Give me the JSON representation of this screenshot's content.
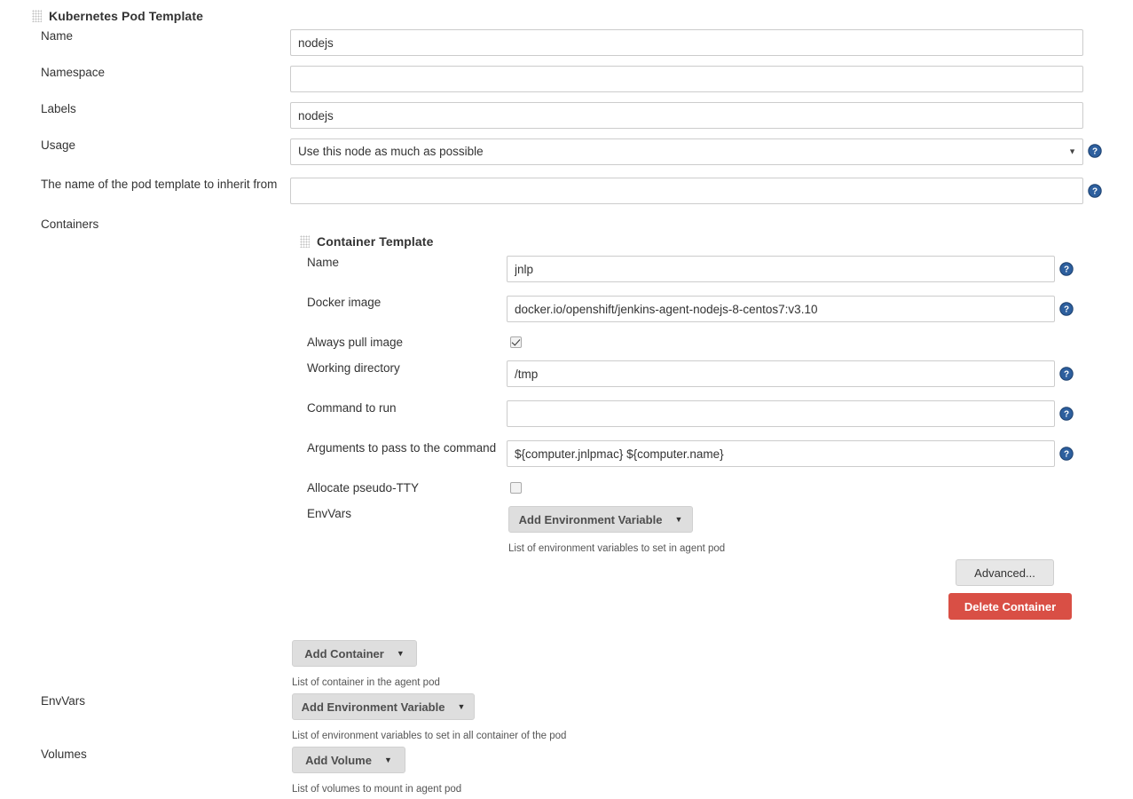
{
  "pod_template": {
    "title": "Kubernetes Pod Template",
    "fields": {
      "name_label": "Name",
      "name_value": "nodejs",
      "namespace_label": "Namespace",
      "namespace_value": "",
      "labels_label": "Labels",
      "labels_value": "nodejs",
      "usage_label": "Usage",
      "usage_value": "Use this node as much as possible",
      "inherit_label": "The name of the pod template to inherit from",
      "inherit_value": "",
      "containers_label": "Containers"
    }
  },
  "container_template": {
    "title": "Container Template",
    "fields": {
      "name_label": "Name",
      "name_value": "jnlp",
      "image_label": "Docker image",
      "image_value": "docker.io/openshift/jenkins-agent-nodejs-8-centos7:v3.10",
      "always_pull_label": "Always pull image",
      "always_pull_checked": true,
      "workdir_label": "Working directory",
      "workdir_value": "/tmp",
      "command_label": "Command to run",
      "command_value": "",
      "args_label": "Arguments to pass to the command",
      "args_value": "${computer.jnlpmac} ${computer.name}",
      "tty_label": "Allocate pseudo-TTY",
      "tty_checked": false,
      "envvars_label": "EnvVars"
    },
    "buttons": {
      "add_env_var": "Add Environment Variable",
      "advanced": "Advanced...",
      "delete_container": "Delete Container"
    },
    "hints": {
      "env_vars": "List of environment variables to set in agent pod"
    }
  },
  "pod_actions": {
    "add_container": "Add Container",
    "add_container_hint": "List of container in the agent pod",
    "envvars_label": "EnvVars",
    "add_env_var": "Add Environment Variable",
    "env_vars_hint": "List of environment variables to set in all container of the pod",
    "volumes_label": "Volumes",
    "add_volume": "Add Volume",
    "volumes_hint": "List of volumes to mount in agent pod"
  },
  "icons": {
    "drag_handle": "drag-handle-icon",
    "help": "help-icon",
    "caret_down": "▼"
  },
  "colors": {
    "danger": "#d94f45",
    "help_blue": "#2d5f9e",
    "button_gray": "#dedede",
    "border": "#cccccc"
  }
}
